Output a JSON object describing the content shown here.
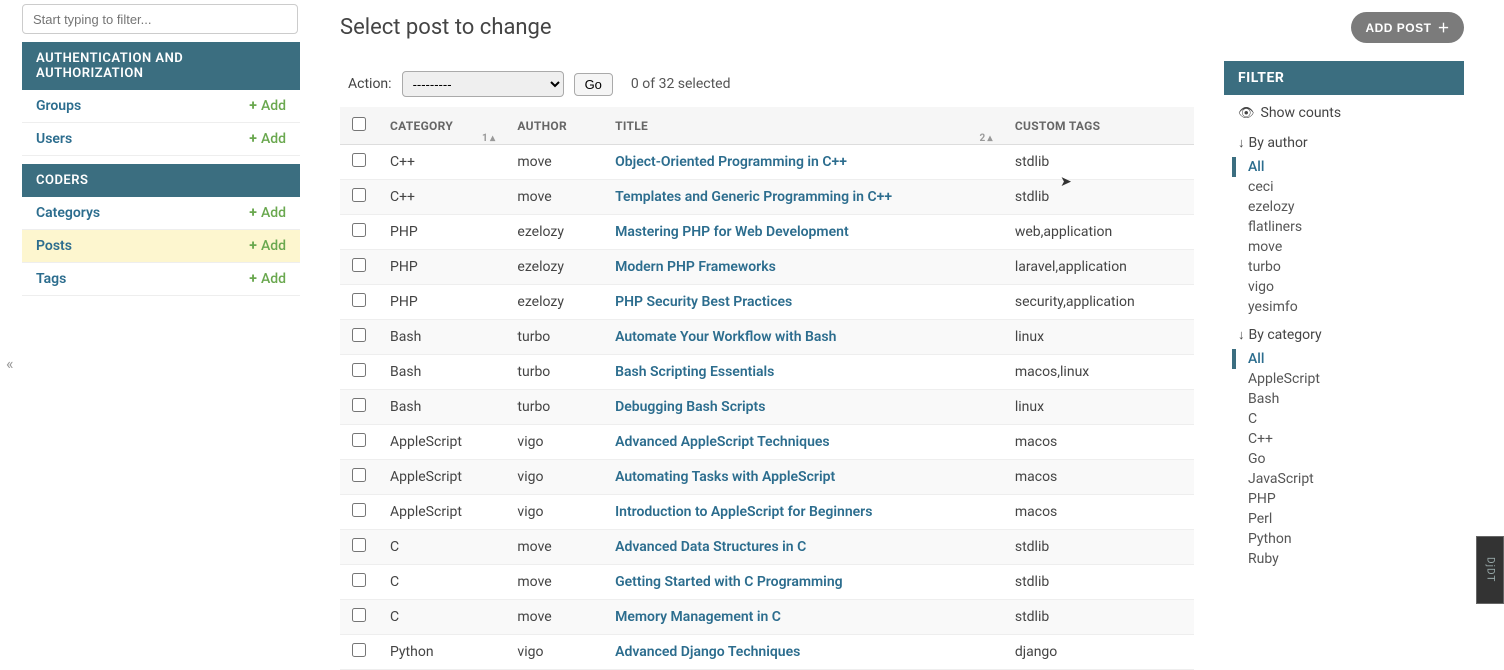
{
  "sidebar": {
    "filter_placeholder": "Start typing to filter...",
    "sections": [
      {
        "title": "AUTHENTICATION AND AUTHORIZATION",
        "items": [
          {
            "label": "Groups",
            "add_label": "Add",
            "active": false
          },
          {
            "label": "Users",
            "add_label": "Add",
            "active": false
          }
        ]
      },
      {
        "title": "CODERS",
        "items": [
          {
            "label": "Categorys",
            "add_label": "Add",
            "active": false
          },
          {
            "label": "Posts",
            "add_label": "Add",
            "active": true
          },
          {
            "label": "Tags",
            "add_label": "Add",
            "active": false
          }
        ]
      }
    ]
  },
  "header": {
    "page_title": "Select post to change",
    "add_button": "ADD POST"
  },
  "actions": {
    "label": "Action:",
    "select_placeholder": "---------",
    "go_label": "Go",
    "selection_text": "0 of 32 selected"
  },
  "columns": {
    "category": "CATEGORY",
    "author": "AUTHOR",
    "title": "TITLE",
    "custom_tags": "CUSTOM TAGS",
    "sort1": "1",
    "sort2": "2"
  },
  "rows": [
    {
      "category": "C++",
      "author": "move",
      "title": "Object-Oriented Programming in C++",
      "tags": "stdlib"
    },
    {
      "category": "C++",
      "author": "move",
      "title": "Templates and Generic Programming in C++",
      "tags": "stdlib"
    },
    {
      "category": "PHP",
      "author": "ezelozy",
      "title": "Mastering PHP for Web Development",
      "tags": "web,application"
    },
    {
      "category": "PHP",
      "author": "ezelozy",
      "title": "Modern PHP Frameworks",
      "tags": "laravel,application"
    },
    {
      "category": "PHP",
      "author": "ezelozy",
      "title": "PHP Security Best Practices",
      "tags": "security,application"
    },
    {
      "category": "Bash",
      "author": "turbo",
      "title": "Automate Your Workflow with Bash",
      "tags": "linux"
    },
    {
      "category": "Bash",
      "author": "turbo",
      "title": "Bash Scripting Essentials",
      "tags": "macos,linux"
    },
    {
      "category": "Bash",
      "author": "turbo",
      "title": "Debugging Bash Scripts",
      "tags": "linux"
    },
    {
      "category": "AppleScript",
      "author": "vigo",
      "title": "Advanced AppleScript Techniques",
      "tags": "macos"
    },
    {
      "category": "AppleScript",
      "author": "vigo",
      "title": "Automating Tasks with AppleScript",
      "tags": "macos"
    },
    {
      "category": "AppleScript",
      "author": "vigo",
      "title": "Introduction to AppleScript for Beginners",
      "tags": "macos"
    },
    {
      "category": "C",
      "author": "move",
      "title": "Advanced Data Structures in C",
      "tags": "stdlib"
    },
    {
      "category": "C",
      "author": "move",
      "title": "Getting Started with C Programming",
      "tags": "stdlib"
    },
    {
      "category": "C",
      "author": "move",
      "title": "Memory Management in C",
      "tags": "stdlib"
    },
    {
      "category": "Python",
      "author": "vigo",
      "title": "Advanced Django Techniques",
      "tags": "django"
    }
  ],
  "filter": {
    "header": "FILTER",
    "show_counts": "Show counts",
    "groups": [
      {
        "title": "By author",
        "items": [
          "All",
          "ceci",
          "ezelozy",
          "flatliners",
          "move",
          "turbo",
          "vigo",
          "yesimfo"
        ],
        "selected": "All"
      },
      {
        "title": "By category",
        "items": [
          "All",
          "AppleScript",
          "Bash",
          "C",
          "C++",
          "Go",
          "JavaScript",
          "PHP",
          "Perl",
          "Python",
          "Ruby"
        ],
        "selected": "All"
      }
    ]
  },
  "djdt": "DjDT"
}
